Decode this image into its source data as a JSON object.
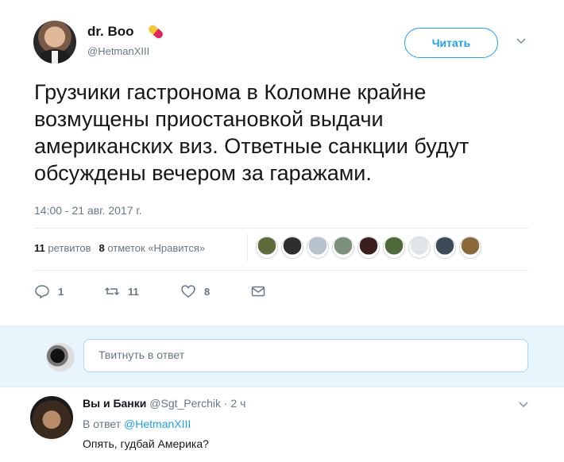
{
  "tweet": {
    "author_name": "dr. Boo",
    "author_handle": "@HetmanXIII",
    "follow_label": "Читать",
    "text": "Грузчики гастронома в Коломне крайне возмущены приостановкой выдачи американских виз. Ответные санкции будут обсуждены вечером за гаражами.",
    "timestamp": "14:00 - 21 авг. 2017 г.",
    "retweets_count": "11",
    "retweets_label": "ретвитов",
    "likes_count": "8",
    "likes_label": "отметок «Нравится»",
    "liker_colors": [
      "#5b6b3a",
      "#2e2e2e",
      "#b7c2cc",
      "#7c8f7a",
      "#3a1f1f",
      "#4f6a3a",
      "#dfe6e9",
      "#3d4a5a",
      "#8a6a3a"
    ],
    "actions": {
      "reply_count": "1",
      "retweet_count": "11",
      "like_count": "8"
    }
  },
  "reply_box": {
    "placeholder": "Твитнуть в ответ"
  },
  "reply": {
    "author_name": "Вы и Банки",
    "author_handle": "@Sgt_Perchik",
    "time": "· 2 ч",
    "reply_to_prefix": "В ответ",
    "reply_to_handle": "@HetmanXIII",
    "text": "Опять, гудбай Америка?"
  },
  "colors": {
    "accent": "#1da1f2",
    "muted": "#657786",
    "reply_bar_bg": "#e8f5fd"
  }
}
